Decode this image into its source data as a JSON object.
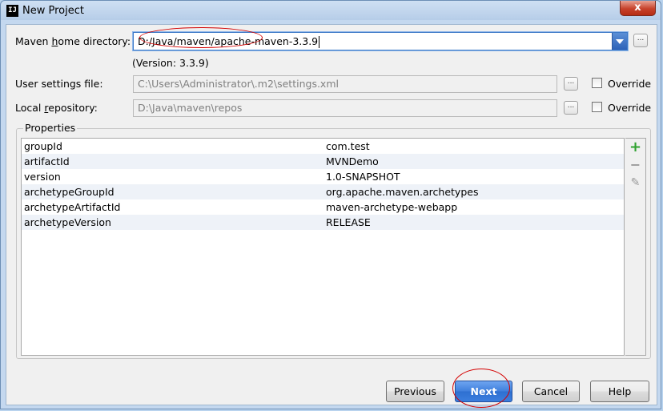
{
  "window": {
    "title": "New Project",
    "app_icon": "IJ",
    "close_glyph": "x"
  },
  "form": {
    "maven_home": {
      "label_pre": "Maven ",
      "label_mnemonic": "h",
      "label_post": "ome directory:",
      "value": "D:/Java/maven/apache-maven-3.3.9",
      "version_note": "(Version: 3.3.9)"
    },
    "user_settings": {
      "label": "User settings file:",
      "value": "C:\\Users\\Administrator\\.m2\\settings.xml",
      "override_label": "Override"
    },
    "local_repo": {
      "label_pre": "Local ",
      "label_mnemonic": "r",
      "label_post": "epository:",
      "value": "D:\\Java\\maven\\repos",
      "override_label": "Override"
    },
    "browse_glyph": "..."
  },
  "properties": {
    "title": "Properties",
    "rows": [
      {
        "key": "groupId",
        "value": "com.test"
      },
      {
        "key": "artifactId",
        "value": "MVNDemo"
      },
      {
        "key": "version",
        "value": "1.0-SNAPSHOT"
      },
      {
        "key": "archetypeGroupId",
        "value": "org.apache.maven.archetypes"
      },
      {
        "key": "archetypeArtifactId",
        "value": "maven-archetype-webapp"
      },
      {
        "key": "archetypeVersion",
        "value": "RELEASE"
      }
    ],
    "tools": {
      "add": "+",
      "remove": "−",
      "edit": "✎"
    }
  },
  "buttons": {
    "previous": "Previous",
    "next": "Next",
    "cancel": "Cancel",
    "help": "Help"
  },
  "colors": {
    "accent": "#3b78c6",
    "annotation": "#d40000",
    "add_green": "#2ea12e"
  }
}
